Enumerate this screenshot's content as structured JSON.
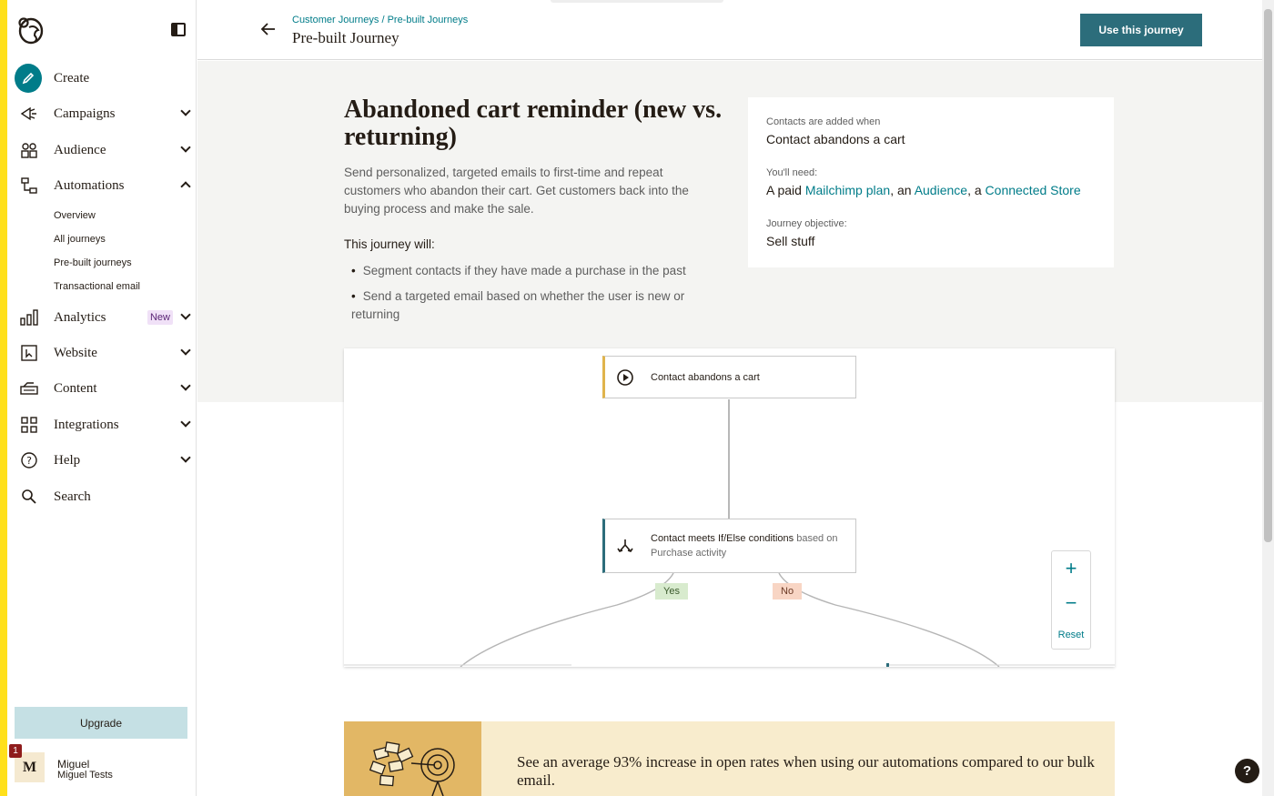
{
  "sidebar": {
    "nav": {
      "create": "Create",
      "campaigns": "Campaigns",
      "audience": "Audience",
      "automations": "Automations",
      "analytics": "Analytics",
      "website": "Website",
      "content": "Content",
      "integrations": "Integrations",
      "help": "Help",
      "search": "Search"
    },
    "analytics_badge": "New",
    "automations_sub": {
      "overview": "Overview",
      "all_journeys": "All journeys",
      "prebuilt": "Pre-built journeys",
      "transactional": "Transactional email"
    },
    "upgrade_label": "Upgrade",
    "user": {
      "avatar_initial": "M",
      "notification_count": "1",
      "name": "Miguel",
      "org": "Miguel Tests"
    }
  },
  "header": {
    "breadcrumb": {
      "first": "Customer Journeys",
      "separator": "/",
      "second": "Pre-built Journeys"
    },
    "title": "Pre-built Journey",
    "use_button": "Use this journey"
  },
  "journey": {
    "title": "Abandoned cart reminder (new vs. returning)",
    "description": "Send personalized, targeted emails to first-time and repeat customers who abandon their cart. Get customers back into the buying process and make the sale.",
    "will_heading": "This journey will:",
    "bullets": [
      "Segment contacts if they have made a purchase in the past",
      "Send a targeted email based on whether the user is new or returning"
    ]
  },
  "info": {
    "added_label": "Contacts are added when",
    "added_value": "Contact abandons a cart",
    "need_label": "You'll need:",
    "need_prefix": "A paid",
    "need_link1": "Mailchimp plan",
    "need_sep1": ", an",
    "need_link2": "Audience",
    "need_sep2": ", a",
    "need_link3": "Connected Store",
    "objective_label": "Journey objective:",
    "objective_value": "Sell stuff"
  },
  "flow": {
    "trigger": "Contact abandons a cart",
    "condition_strong": "Contact meets If/Else conditions",
    "condition_muted": "based on",
    "condition_line2": "Purchase activity",
    "yes": "Yes",
    "no": "No",
    "zoom_reset": "Reset"
  },
  "promo": {
    "text": "See an average 93% increase in open rates when using our automations compared to our bulk email."
  },
  "colors": {
    "teal": "#007c89",
    "button": "#2c6d7b",
    "accent_yellow": "#ffe01b",
    "trigger_border": "#e0b44c"
  },
  "icons": [
    "mailchimp-logo-icon",
    "sidebar-toggle-icon",
    "pencil-icon",
    "megaphone-icon",
    "audience-icon",
    "automations-icon",
    "bar-chart-icon",
    "website-icon",
    "content-icon",
    "grid-icon",
    "question-circle-icon",
    "search-icon",
    "back-arrow-icon",
    "play-circle-icon",
    "split-icon",
    "plus-icon",
    "minus-icon"
  ]
}
